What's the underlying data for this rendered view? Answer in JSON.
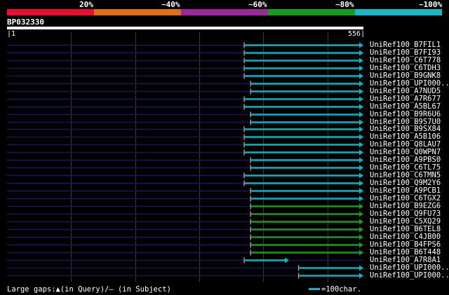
{
  "legend": {
    "colors": [
      "#e8102e",
      "#e0701a",
      "#9a2a9c",
      "#1a9c1a",
      "#1ab8c6"
    ],
    "ticks": [
      "20%",
      "~40%",
      "~60%",
      "~80%",
      "~100%"
    ]
  },
  "query": {
    "name": "BP032330",
    "start": "1",
    "end": "556"
  },
  "hits": [
    {
      "id": "UniRef100_B7FIL1",
      "color": "#00b8c6",
      "from_char": 370,
      "to_char": 556
    },
    {
      "id": "UniRef100_B7FI93",
      "color": "#00b8c6",
      "from_char": 370,
      "to_char": 556
    },
    {
      "id": "UniRef100_C6T778",
      "color": "#00b8c6",
      "from_char": 370,
      "to_char": 556
    },
    {
      "id": "UniRef100_C6TDH3",
      "color": "#00b8c6",
      "from_char": 370,
      "to_char": 556
    },
    {
      "id": "UniRef100_B9GNK8",
      "color": "#00b8c6",
      "from_char": 370,
      "to_char": 556
    },
    {
      "id": "UniRef100_UPI000..",
      "color": "#00b8c6",
      "from_char": 380,
      "to_char": 556
    },
    {
      "id": "UniRef100_A7NUD5",
      "color": "#00b8c6",
      "from_char": 380,
      "to_char": 556
    },
    {
      "id": "UniRef100_A7R677",
      "color": "#00b8c6",
      "from_char": 370,
      "to_char": 556
    },
    {
      "id": "UniRef100_A5BL67",
      "color": "#00b8c6",
      "from_char": 370,
      "to_char": 556
    },
    {
      "id": "UniRef100_B9R6U6",
      "color": "#00b8c6",
      "from_char": 380,
      "to_char": 556
    },
    {
      "id": "UniRef100_B9S7U0",
      "color": "#00b8c6",
      "from_char": 380,
      "to_char": 556
    },
    {
      "id": "UniRef100_B9SX84",
      "color": "#00b8c6",
      "from_char": 370,
      "to_char": 556
    },
    {
      "id": "UniRef100_A5B106",
      "color": "#00b8c6",
      "from_char": 370,
      "to_char": 556
    },
    {
      "id": "UniRef100_Q8LAU7",
      "color": "#00b8c6",
      "from_char": 370,
      "to_char": 556
    },
    {
      "id": "UniRef100_Q0WPN7",
      "color": "#00b8c6",
      "from_char": 370,
      "to_char": 556
    },
    {
      "id": "UniRef100_A9PBS0",
      "color": "#00b8c6",
      "from_char": 380,
      "to_char": 556
    },
    {
      "id": "UniRef100_C6TL75",
      "color": "#00b8c6",
      "from_char": 380,
      "to_char": 556
    },
    {
      "id": "UniRef100_C6TMN5",
      "color": "#00b8c6",
      "from_char": 370,
      "to_char": 556
    },
    {
      "id": "UniRef100_Q9M2Y6",
      "color": "#00b8c6",
      "from_char": 370,
      "to_char": 556
    },
    {
      "id": "UniRef100_A9PCB1",
      "color": "#00b8c6",
      "from_char": 380,
      "to_char": 556
    },
    {
      "id": "UniRef100_C6TGX2",
      "color": "#00b8c6",
      "from_char": 380,
      "to_char": 556
    },
    {
      "id": "UniRef100_B9EZG6",
      "color": "#1a9c1a",
      "from_char": 380,
      "to_char": 556
    },
    {
      "id": "UniRef100_Q9FU73",
      "color": "#1a9c1a",
      "from_char": 380,
      "to_char": 556
    },
    {
      "id": "UniRef100_C5XQ29",
      "color": "#1a9c1a",
      "from_char": 380,
      "to_char": 556
    },
    {
      "id": "UniRef100_B6TEL8",
      "color": "#1a9c1a",
      "from_char": 380,
      "to_char": 556
    },
    {
      "id": "UniRef100_C4JB00",
      "color": "#1a9c1a",
      "from_char": 380,
      "to_char": 556
    },
    {
      "id": "UniRef100_B4FPS6",
      "color": "#1a9c1a",
      "from_char": 380,
      "to_char": 556
    },
    {
      "id": "UniRef100_B6T448",
      "color": "#1a9c1a",
      "from_char": 380,
      "to_char": 556
    },
    {
      "id": "UniRef100_A7R8A1",
      "color": "#00b8c6",
      "from_char": 370,
      "to_char": 440
    },
    {
      "id": "UniRef100_UPI000..",
      "color": "#00b8c6",
      "from_char": 455,
      "to_char": 556
    },
    {
      "id": "UniRef100_UPI000..",
      "color": "#00b8c6",
      "from_char": 455,
      "to_char": 556
    }
  ],
  "footer": {
    "gaps_text": "Large gaps:▲(in Query)/— (in Subject)",
    "scale_text": "=100char."
  }
}
